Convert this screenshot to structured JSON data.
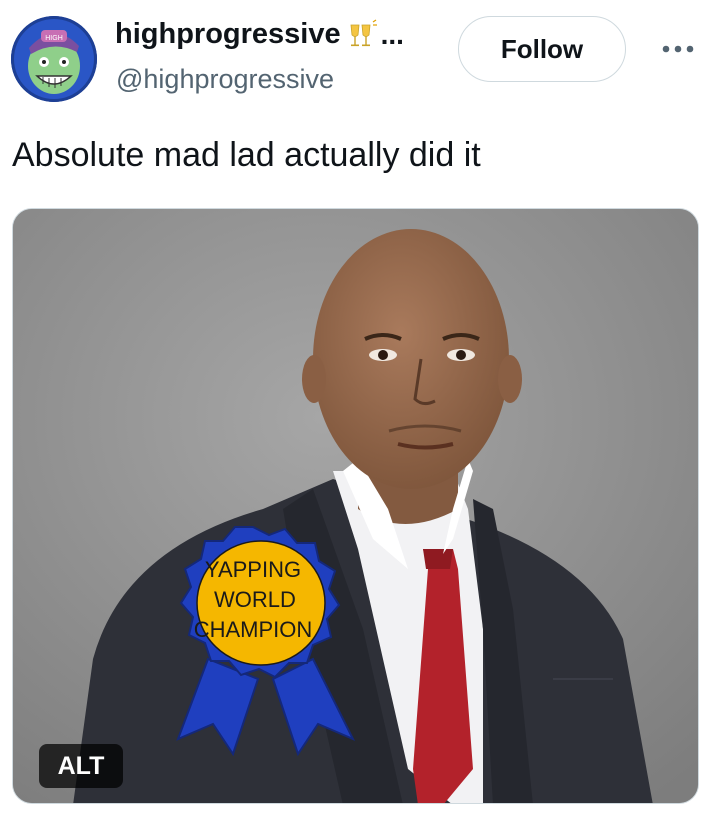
{
  "author": {
    "display_name": "highprogressive",
    "emoji_icon": "clinking-glasses-icon",
    "truncation": "...",
    "handle": "@highprogressive"
  },
  "follow_label": "Follow",
  "tweet": {
    "text": "Absolute mad lad actually did it"
  },
  "media": {
    "alt_label": "ALT",
    "badge": {
      "line1": "YAPPING",
      "line2": "WORLD",
      "line3": "CHAMPION"
    }
  },
  "colors": {
    "text_primary": "#0f1419",
    "text_secondary": "#536471",
    "border": "#cfd9de",
    "ribbon_blue": "#1f3fbf",
    "ribbon_gold": "#f5b700"
  }
}
